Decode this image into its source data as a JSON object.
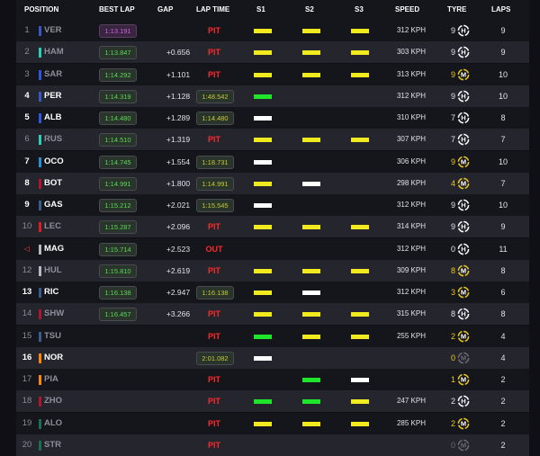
{
  "header": {
    "position": "POSITION",
    "best_lap": "BEST LAP",
    "gap": "GAP",
    "lap_time": "LAP TIME",
    "s1": "S1",
    "s2": "S2",
    "s3": "S3",
    "speed": "SPEED",
    "tyre": "TYRE",
    "laps": "LAPS"
  },
  "colors": {
    "sector_yellow": "#f0ea1e",
    "sector_green": "#1fe62a",
    "sector_white": "#ffffff",
    "pit_red": "#ff2a2a",
    "best_lap_green": "#5ad95a",
    "fastest_purple": "#d05ee8"
  },
  "rows": [
    {
      "pos": "1",
      "driver": "VER",
      "team_color": "#3559c4",
      "best": "1:13.191",
      "best_purple": true,
      "gap": "",
      "lap_time": "PIT",
      "lap_type": "status",
      "s1": "yellow",
      "s2": "yellow",
      "s3": "yellow",
      "speed": "312 KPH",
      "tyre_laps": "9",
      "tyre": "H",
      "laps": "9",
      "highlight": false
    },
    {
      "pos": "2",
      "driver": "HAM",
      "team_color": "#27d2b4",
      "best": "1:13.847",
      "best_purple": false,
      "gap": "+0.656",
      "lap_time": "PIT",
      "lap_type": "status",
      "s1": "yellow",
      "s2": "yellow",
      "s3": "yellow",
      "speed": "303 KPH",
      "tyre_laps": "9",
      "tyre": "H",
      "laps": "9",
      "highlight": false
    },
    {
      "pos": "3",
      "driver": "SAR",
      "team_color": "#2c58e0",
      "best": "1:14.292",
      "best_purple": false,
      "gap": "+1.101",
      "lap_time": "PIT",
      "lap_type": "status",
      "s1": "yellow",
      "s2": "yellow",
      "s3": "yellow",
      "speed": "313 KPH",
      "tyre_laps": "9",
      "tyre": "M",
      "laps": "10",
      "highlight": false
    },
    {
      "pos": "4",
      "driver": "PER",
      "team_color": "#3559c4",
      "best": "1:14.319",
      "best_purple": false,
      "gap": "+1.128",
      "lap_time": "1:48.542",
      "lap_type": "time",
      "s1": "green",
      "s2": "",
      "s3": "",
      "speed": "312 KPH",
      "tyre_laps": "9",
      "tyre": "H",
      "laps": "10",
      "highlight": true
    },
    {
      "pos": "5",
      "driver": "ALB",
      "team_color": "#2c58e0",
      "best": "1:14.480",
      "best_purple": false,
      "gap": "+1.289",
      "lap_time": "1:14.480",
      "lap_type": "time",
      "s1": "white",
      "s2": "",
      "s3": "",
      "speed": "310 KPH",
      "tyre_laps": "7",
      "tyre": "H",
      "laps": "8",
      "highlight": true
    },
    {
      "pos": "6",
      "driver": "RUS",
      "team_color": "#27d2b4",
      "best": "1:14.510",
      "best_purple": false,
      "gap": "+1.319",
      "lap_time": "PIT",
      "lap_type": "status",
      "s1": "yellow",
      "s2": "yellow",
      "s3": "yellow",
      "speed": "307 KPH",
      "tyre_laps": "7",
      "tyre": "H",
      "laps": "7",
      "highlight": false
    },
    {
      "pos": "7",
      "driver": "OCO",
      "team_color": "#2193d1",
      "best": "1:14.745",
      "best_purple": false,
      "gap": "+1.554",
      "lap_time": "1:18.731",
      "lap_type": "time",
      "s1": "white",
      "s2": "",
      "s3": "",
      "speed": "306 KPH",
      "tyre_laps": "9",
      "tyre": "M",
      "laps": "10",
      "highlight": true
    },
    {
      "pos": "8",
      "driver": "BOT",
      "team_color": "#b1172c",
      "best": "1:14.991",
      "best_purple": false,
      "gap": "+1.800",
      "lap_time": "1:14.991",
      "lap_type": "time",
      "s1": "yellow",
      "s2": "white",
      "s3": "",
      "speed": "298 KPH",
      "tyre_laps": "4",
      "tyre": "M",
      "laps": "7",
      "highlight": true
    },
    {
      "pos": "9",
      "driver": "GAS",
      "team_color": "#3a5b8e",
      "best": "1:15.212",
      "best_purple": false,
      "gap": "+2.021",
      "lap_time": "1:15.545",
      "lap_type": "time",
      "s1": "white",
      "s2": "",
      "s3": "",
      "speed": "312 KPH",
      "tyre_laps": "9",
      "tyre": "H",
      "laps": "10",
      "highlight": true
    },
    {
      "pos": "10",
      "driver": "LEC",
      "team_color": "#d81e1e",
      "best": "1:15.287",
      "best_purple": false,
      "gap": "+2.096",
      "lap_time": "PIT",
      "lap_type": "status",
      "s1": "yellow",
      "s2": "yellow",
      "s3": "yellow",
      "speed": "314 KPH",
      "tyre_laps": "9",
      "tyre": "H",
      "laps": "9",
      "highlight": false
    },
    {
      "pos": "◁",
      "driver": "MAG",
      "team_color": "#b6babd",
      "best": "1:15.714",
      "best_purple": false,
      "gap": "+2.523",
      "lap_time": "OUT",
      "lap_type": "status",
      "s1": "",
      "s2": "",
      "s3": "",
      "speed": "312 KPH",
      "tyre_laps": "0",
      "tyre": "H",
      "laps": "11",
      "highlight": true
    },
    {
      "pos": "12",
      "driver": "HUL",
      "team_color": "#b6babd",
      "best": "1:15.810",
      "best_purple": false,
      "gap": "+2.619",
      "lap_time": "PIT",
      "lap_type": "status",
      "s1": "yellow",
      "s2": "yellow",
      "s3": "yellow",
      "speed": "309 KPH",
      "tyre_laps": "8",
      "tyre": "M",
      "laps": "8",
      "highlight": false
    },
    {
      "pos": "13",
      "driver": "RIC",
      "team_color": "#3a5b8e",
      "best": "1:16.138",
      "best_purple": false,
      "gap": "+2.947",
      "lap_time": "1:16.138",
      "lap_type": "time",
      "s1": "yellow",
      "s2": "white",
      "s3": "",
      "speed": "312 KPH",
      "tyre_laps": "3",
      "tyre": "M",
      "laps": "6",
      "highlight": true
    },
    {
      "pos": "14",
      "driver": "SHW",
      "team_color": "#b1172c",
      "best": "1:16.457",
      "best_purple": false,
      "gap": "+3.266",
      "lap_time": "PIT",
      "lap_type": "status",
      "s1": "yellow",
      "s2": "yellow",
      "s3": "yellow",
      "speed": "315 KPH",
      "tyre_laps": "8",
      "tyre": "H",
      "laps": "8",
      "highlight": false
    },
    {
      "pos": "15",
      "driver": "TSU",
      "team_color": "#3a5b8e",
      "best": "",
      "best_purple": false,
      "gap": "",
      "lap_time": "PIT",
      "lap_type": "status",
      "s1": "green",
      "s2": "yellow",
      "s3": "yellow",
      "speed": "255 KPH",
      "tyre_laps": "2",
      "tyre": "M",
      "laps": "4",
      "highlight": false
    },
    {
      "pos": "16",
      "driver": "NOR",
      "team_color": "#ff8700",
      "best": "",
      "best_purple": false,
      "gap": "",
      "lap_time": "2:01.082",
      "lap_type": "time",
      "s1": "white",
      "s2": "",
      "s3": "",
      "speed": "",
      "tyre_laps": "0",
      "tyre": "M",
      "laps": "4",
      "highlight": true
    },
    {
      "pos": "17",
      "driver": "PIA",
      "team_color": "#ff8700",
      "best": "",
      "best_purple": false,
      "gap": "",
      "lap_time": "PIT",
      "lap_type": "status",
      "s1": "",
      "s2": "green",
      "s3": "white",
      "speed": "",
      "tyre_laps": "1",
      "tyre": "M",
      "laps": "2",
      "highlight": false
    },
    {
      "pos": "18",
      "driver": "ZHO",
      "team_color": "#b1172c",
      "best": "",
      "best_purple": false,
      "gap": "",
      "lap_time": "PIT",
      "lap_type": "status",
      "s1": "green",
      "s2": "green",
      "s3": "yellow",
      "speed": "247 KPH",
      "tyre_laps": "2",
      "tyre": "H",
      "laps": "2",
      "highlight": false
    },
    {
      "pos": "19",
      "driver": "ALO",
      "team_color": "#1a6e52",
      "best": "",
      "best_purple": false,
      "gap": "",
      "lap_time": "PIT",
      "lap_type": "status",
      "s1": "yellow",
      "s2": "yellow",
      "s3": "yellow",
      "speed": "285 KPH",
      "tyre_laps": "2",
      "tyre": "M",
      "laps": "2",
      "highlight": false
    },
    {
      "pos": "20",
      "driver": "STR",
      "team_color": "#1a6e52",
      "best": "",
      "best_purple": false,
      "gap": "",
      "lap_time": "PIT",
      "lap_type": "status",
      "s1": "",
      "s2": "",
      "s3": "",
      "speed": "",
      "tyre_laps": "0",
      "tyre": "M",
      "laps": "2",
      "highlight": false
    }
  ]
}
